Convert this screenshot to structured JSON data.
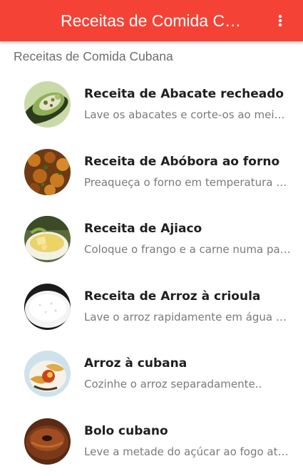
{
  "appbar": {
    "title": "Receitas de Comida Cubana",
    "background_color": "#f44336",
    "menu_icon": "more-vert-icon"
  },
  "section_header": "Receitas de Comida Cubana",
  "recipes": [
    {
      "title": "Receita de Abacate recheado",
      "subtitle": "Lave os abacates e corte-os ao meio no sentido do comprimento",
      "thumbnail": "stuffed-avocado-photo"
    },
    {
      "title": "Receita de Abóbora ao forno",
      "subtitle": "Preaqueça o forno em temperatura média",
      "thumbnail": "baked-pumpkin-photo"
    },
    {
      "title": "Receita de Ajiaco",
      "subtitle": "Coloque o frango e a carne numa panela com água",
      "thumbnail": "ajiaco-stew-photo"
    },
    {
      "title": "Receita de Arroz à crioula",
      "subtitle": "Lave o arroz rapidamente em água corrente",
      "thumbnail": "creole-rice-photo"
    },
    {
      "title": "Arroz à cubana",
      "subtitle": "Cozinhe o arroz separadamente..",
      "thumbnail": "cuban-rice-photo"
    },
    {
      "title": "Bolo cubano",
      "subtitle": "Leve a metade do açúcar ao fogo ate caramelizar",
      "thumbnail": "cuban-cake-photo"
    }
  ]
}
